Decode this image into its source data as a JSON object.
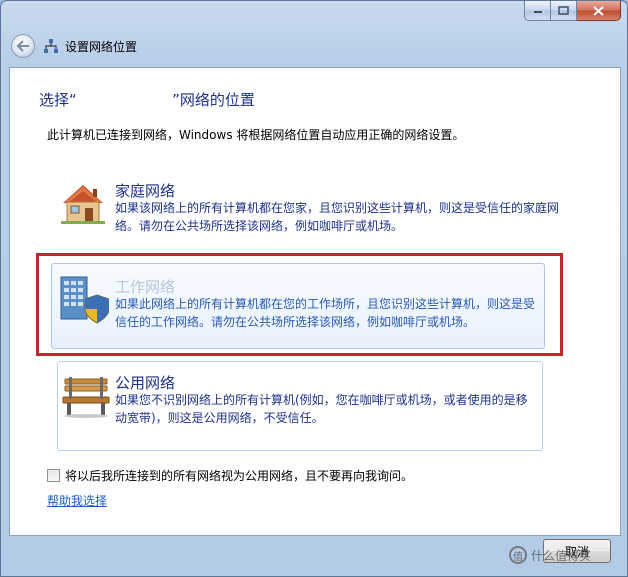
{
  "window": {
    "title": "设置网络位置",
    "caption_buttons": [
      "minimize-icon",
      "maximize-icon",
      "close-icon"
    ]
  },
  "content": {
    "heading": "选择“                    ”网络的位置",
    "description": "此计算机已连接到网络，Windows 将根据网络位置自动应用正确的网络设置。"
  },
  "options": [
    {
      "id": "home",
      "title": "家庭网络",
      "desc": "如果该网络上的所有计算机都在您家，且您识别这些计算机，则这是受信任的家庭网络。请勿在公共场所选择该网络，例如咖啡厅或机场。",
      "icon": "house-icon"
    },
    {
      "id": "work",
      "title": "工作网络",
      "desc": "如果此网络上的所有计算机都在您的工作场所，且您识别这些计算机，则这是受信任的工作网络。请勿在公共场所选择该网络，例如咖啡厅或机场。",
      "icon": "office-building-icon"
    },
    {
      "id": "public",
      "title": "公用网络",
      "desc": "如果您不识别网络上的所有计算机(例如，您在咖啡厅或机场，或者使用的是移动宽带)，则这是公用网络，不受信任。",
      "icon": "park-bench-icon"
    }
  ],
  "checkbox": {
    "label": "将以后我所连接到的所有网络视为公用网络，且不要再向我询问。",
    "checked": false
  },
  "help_link": "帮助我选择",
  "buttons": {
    "cancel": "取消"
  },
  "watermark": "什么值得买",
  "colors": {
    "heading": "#1e3287",
    "highlight_border": "#c0272d",
    "link": "#1a5fbf"
  }
}
